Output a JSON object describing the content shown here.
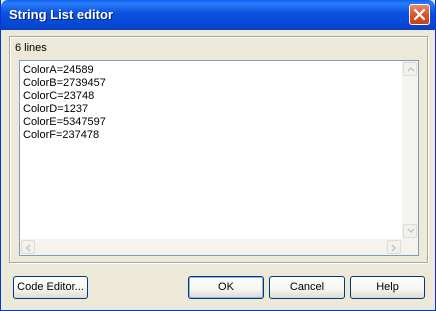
{
  "window": {
    "title": "String List editor"
  },
  "editor": {
    "line_count_label": "6 lines",
    "lines": [
      "ColorA=24589",
      "ColorB=2739457",
      "ColorC=23748",
      "ColorD=1237",
      "ColorE=5347597",
      "ColorF=237478"
    ]
  },
  "buttons": {
    "code_editor": "Code Editor...",
    "ok": "OK",
    "cancel": "Cancel",
    "help": "Help"
  },
  "icons": {
    "close": "close-icon",
    "scroll_up": "chevron-up-icon",
    "scroll_down": "chevron-down-icon",
    "scroll_left": "chevron-left-icon",
    "scroll_right": "chevron-right-icon"
  },
  "colors": {
    "titlebar": "#0a52de",
    "close": "#d8542e",
    "dialog_bg": "#ece9d8"
  }
}
